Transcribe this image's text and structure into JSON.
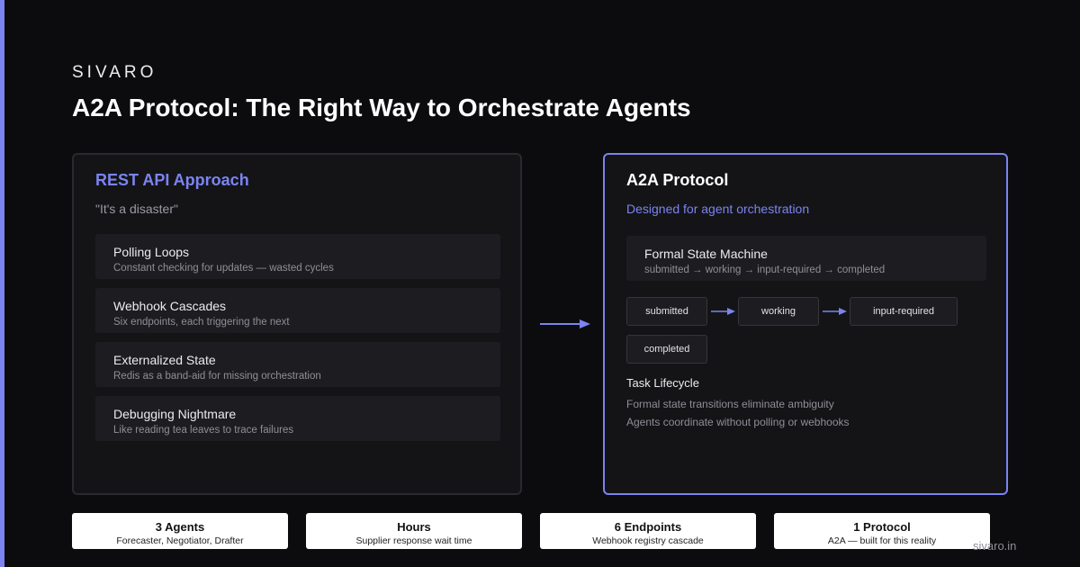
{
  "brand": "SIVARO",
  "title": "A2A Protocol: The Right Way to Orchestrate Agents",
  "rest_panel": {
    "heading": "REST API Approach",
    "subheading": "\"It's a disaster\"",
    "items": [
      {
        "title": "Polling Loops",
        "desc": "Constant checking for updates — wasted cycles"
      },
      {
        "title": "Webhook Cascades",
        "desc": "Six endpoints, each triggering the next"
      },
      {
        "title": "Externalized State",
        "desc": "Redis as a band-aid for missing orchestration"
      },
      {
        "title": "Debugging Nightmare",
        "desc": "Like reading tea leaves to trace failures"
      }
    ]
  },
  "a2a_panel": {
    "heading": "A2A Protocol",
    "subheading": "Designed for agent orchestration",
    "state_machine": {
      "title": "Formal State Machine",
      "desc": "submitted → working → input-required → completed"
    },
    "states": [
      "submitted",
      "working",
      "input-required",
      "completed"
    ],
    "lifecycle": {
      "title": "Task Lifecycle",
      "lines": [
        "Formal state transitions eliminate ambiguity",
        "Agents coordinate without polling or webhooks"
      ]
    }
  },
  "stats": [
    {
      "value": "3 Agents",
      "label": "Forecaster, Negotiator, Drafter"
    },
    {
      "value": "Hours",
      "label": "Supplier response wait time"
    },
    {
      "value": "6 Endpoints",
      "label": "Webhook registry cascade"
    },
    {
      "value": "1 Protocol",
      "label": "A2A — built for this reality"
    }
  ],
  "footer_url": "sivaro.in",
  "colors": {
    "accent": "#7b84f0",
    "background": "#0c0c0e",
    "panel": "#141417",
    "card": "#1d1d21"
  }
}
